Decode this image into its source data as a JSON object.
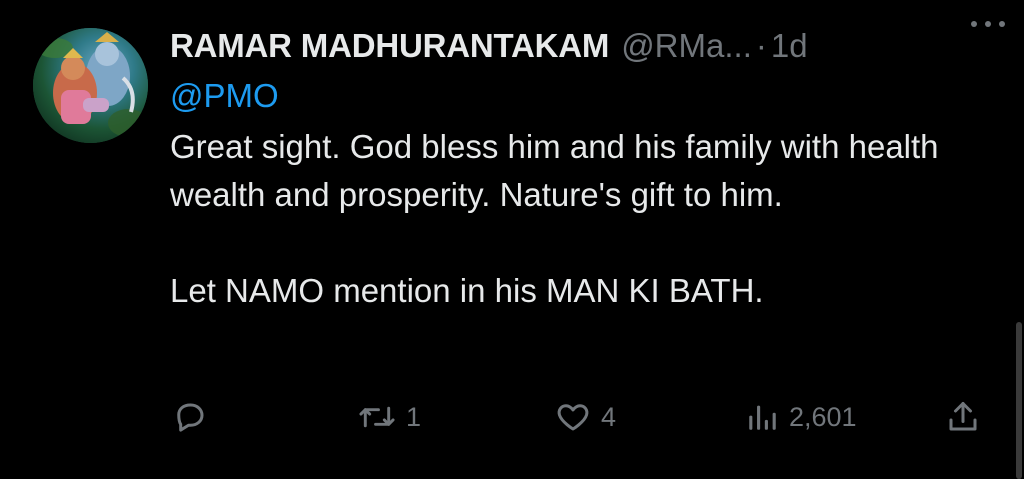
{
  "tweet": {
    "display_name": "RAMAR MADHURANTAKAM",
    "handle": "@RMa...",
    "separator": "·",
    "time": "1d",
    "reply_to": "@PMO",
    "body_paragraphs": [
      "Great sight. God bless him and his family with health wealth and prosperity. Nature's gift to him.",
      "Let NAMO mention in his MAN KI BATH."
    ]
  },
  "actions": {
    "reply_count": "",
    "retweet_count": "1",
    "like_count": "4",
    "views_count": "2,601"
  },
  "icons": {
    "more": "more-horizontal-icon",
    "reply": "reply-icon",
    "retweet": "retweet-icon",
    "like": "heart-icon",
    "views": "views-icon",
    "share": "share-icon"
  },
  "colors": {
    "background": "#000000",
    "primary_text": "#e7e9ea",
    "secondary_text": "#71767b",
    "link": "#1d9bf0"
  }
}
